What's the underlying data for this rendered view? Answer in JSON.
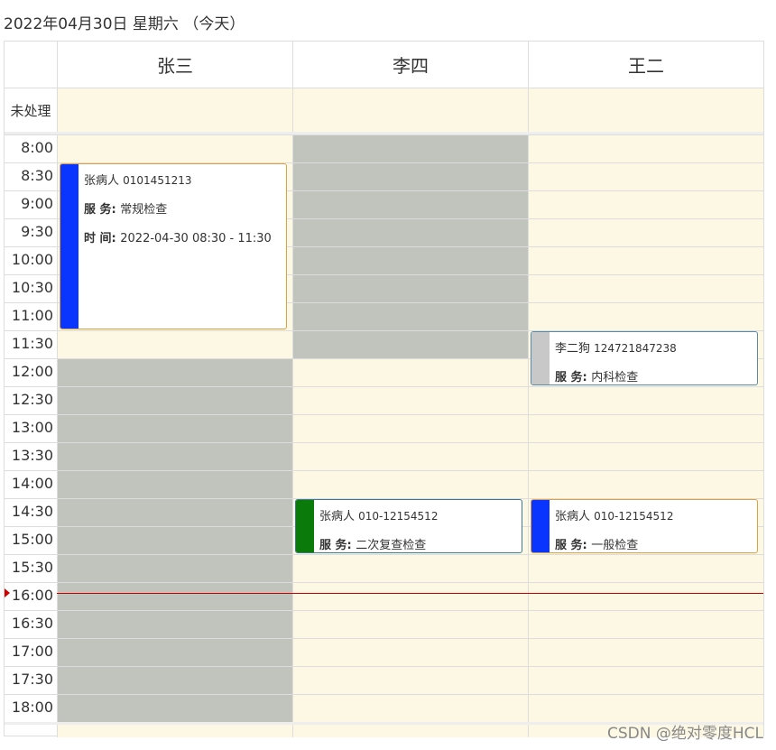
{
  "header": {
    "date_title": "2022年04月30日 星期六 （今天）"
  },
  "resources": [
    {
      "name": "张三"
    },
    {
      "name": "李四"
    },
    {
      "name": "王二"
    }
  ],
  "allday": {
    "label": "未处理"
  },
  "times": [
    "8:00",
    "8:30",
    "9:00",
    "9:30",
    "10:00",
    "10:30",
    "11:00",
    "11:30",
    "12:00",
    "12:30",
    "13:00",
    "13:30",
    "14:00",
    "14:30",
    "15:00",
    "15:30",
    "16:00",
    "16:30",
    "17:00",
    "17:30",
    "18:00"
  ],
  "events": [
    {
      "resource": "张三",
      "patient": "张病人",
      "phone": "0101451213",
      "service_label": "服 务:",
      "service": "常规检查",
      "time_label": "时 间:",
      "time": "2022-04-30 08:30 - 11:30",
      "start": "8:30",
      "end": "11:30",
      "bar_color": "#0a35ff",
      "border_color": "#e0a040"
    },
    {
      "resource": "王二",
      "patient": "李二狗",
      "phone": "124721847238",
      "service_label": "服 务:",
      "service": "内科检查",
      "start": "11:30",
      "end": "12:30",
      "bar_color": "#c8c8c8",
      "border_color": "#5a8aa8"
    },
    {
      "resource": "李四",
      "patient": "张病人",
      "phone": "010-12154512",
      "service_label": "服 务:",
      "service": "二次复查检查",
      "start": "14:30",
      "end": "15:30",
      "bar_color": "#0a7a0a",
      "border_color": "#3b7a90"
    },
    {
      "resource": "王二",
      "patient": "张病人",
      "phone": "010-12154512",
      "service_label": "服 务:",
      "service": "一般检查",
      "start": "14:30",
      "end": "15:30",
      "bar_color": "#0a35ff",
      "border_color": "#e0a040"
    }
  ],
  "unavailable": [
    {
      "resource": "李四",
      "start": "8:00",
      "end": "12:00"
    },
    {
      "resource": "张三",
      "start": "12:00",
      "end": "18:30"
    }
  ],
  "now": "16:12",
  "colors": {
    "slot_bg": "#fcf8e3",
    "unavailable": "#c0c4bd",
    "now_line": "#d00000"
  },
  "watermark": "CSDN @绝对零度HCL"
}
